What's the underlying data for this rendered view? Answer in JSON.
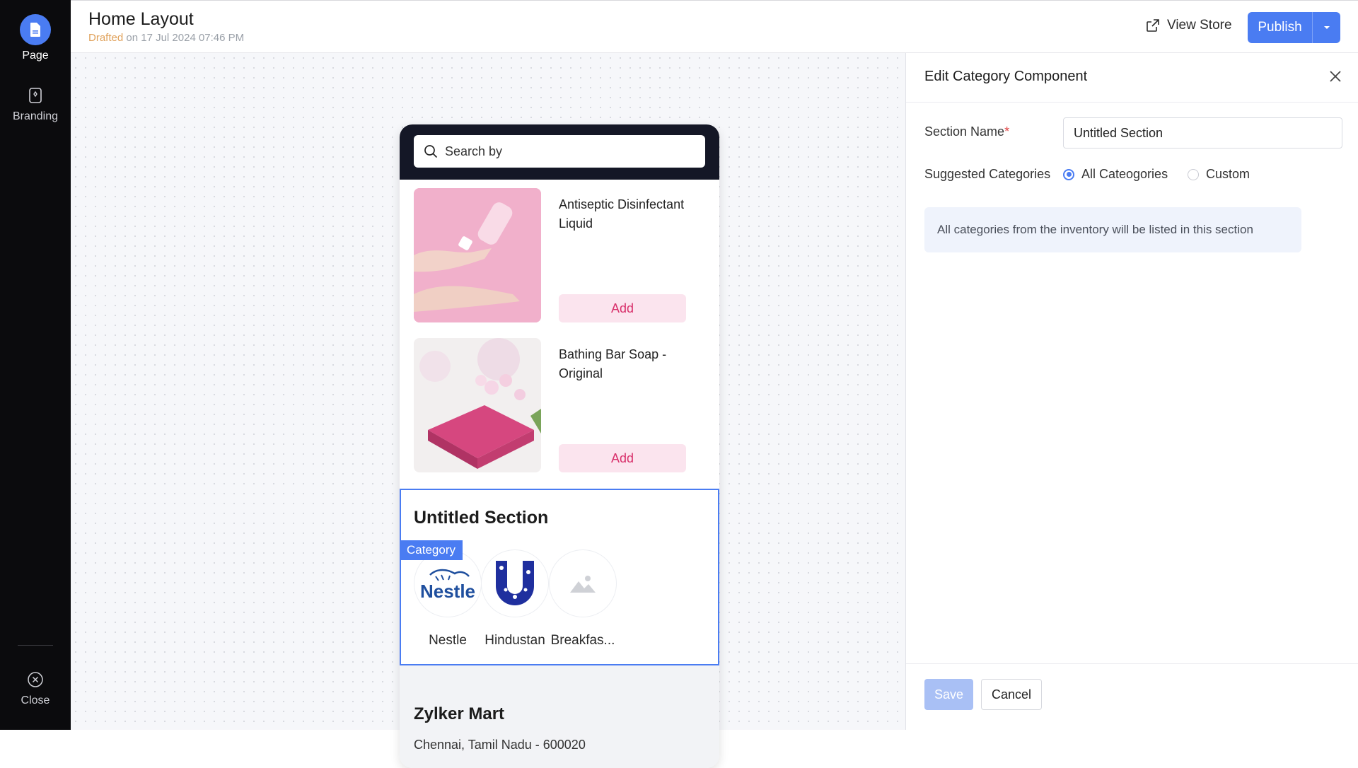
{
  "sidebar": {
    "items": [
      {
        "label": "Page",
        "icon": "page-icon"
      },
      {
        "label": "Branding",
        "icon": "branding-icon"
      }
    ],
    "close_label": "Close"
  },
  "header": {
    "title": "Home Layout",
    "drafted_word": "Drafted",
    "drafted_rest": "on 17 Jul 2024 07:46 PM",
    "view_store": "View Store",
    "publish": "Publish"
  },
  "preview": {
    "search_placeholder": "Search by",
    "products": [
      {
        "name": "Antiseptic Disinfectant Liquid",
        "add": "Add"
      },
      {
        "name": "Bathing Bar Soap - Original",
        "add": "Add"
      }
    ],
    "category_tag": "Category",
    "section_title": "Untitled Section",
    "categories": [
      {
        "name": "Nestle"
      },
      {
        "name": "Hindustan"
      },
      {
        "name": "Breakfas..."
      }
    ],
    "store_name": "Zylker Mart",
    "store_address": "Chennai, Tamil Nadu - 600020"
  },
  "panel": {
    "title": "Edit Category Component",
    "section_name_label": "Section Name",
    "required_mark": "*",
    "section_name_value": "Untitled Section",
    "suggested_label": "Suggested Categories",
    "options": [
      "All Cateogories",
      "Custom"
    ],
    "selected_option": "All Cateogories",
    "info": "All categories from the inventory will be listed in this section",
    "save": "Save",
    "cancel": "Cancel"
  },
  "colors": {
    "accent": "#4a7cf2",
    "sidebar_bg": "#0b0b0d",
    "add_button_bg": "#fbe4ee",
    "add_button_text": "#d8306b",
    "drafted": "#e0a15a"
  }
}
